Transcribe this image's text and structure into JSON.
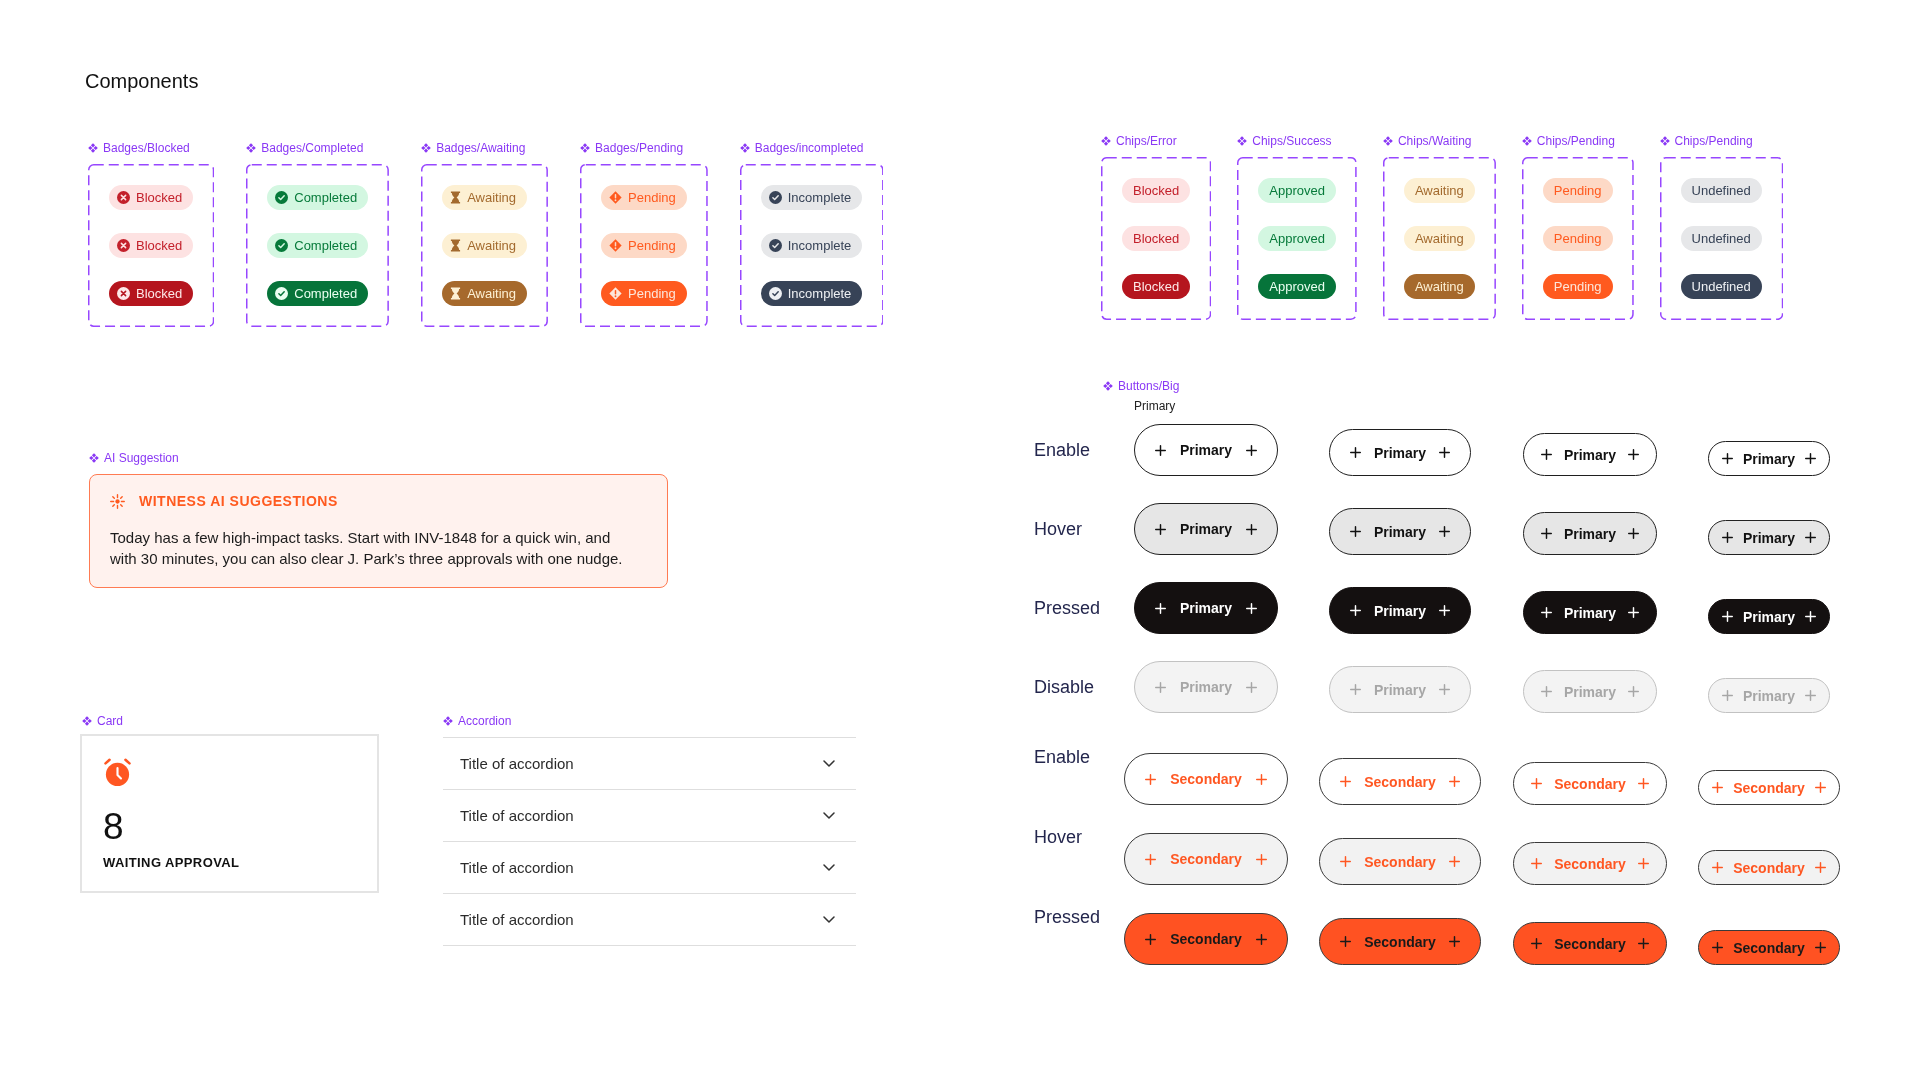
{
  "page": {
    "title": "Components"
  },
  "badge_sets": [
    {
      "label": "Badges/Blocked",
      "kind": "blocked",
      "badges": [
        {
          "text": "Blocked",
          "kind": "soft"
        },
        {
          "text": "Blocked",
          "kind": "outline"
        },
        {
          "text": "Blocked",
          "kind": "solid"
        }
      ]
    },
    {
      "label": "Badges/Completed",
      "kind": "completed",
      "badges": [
        {
          "text": "Completed",
          "kind": "soft"
        },
        {
          "text": "Completed",
          "kind": "outline"
        },
        {
          "text": "Completed",
          "kind": "solid"
        }
      ]
    },
    {
      "label": "Badges/Awaiting",
      "kind": "awaiting",
      "badges": [
        {
          "text": "Awaiting",
          "kind": "soft"
        },
        {
          "text": "Awaiting",
          "kind": "outline"
        },
        {
          "text": "Awaiting",
          "kind": "solid"
        }
      ]
    },
    {
      "label": "Badges/Pending",
      "kind": "pending",
      "badges": [
        {
          "text": "Pending",
          "kind": "soft"
        },
        {
          "text": "Pending",
          "kind": "outline"
        },
        {
          "text": "Pending",
          "kind": "solid"
        }
      ]
    },
    {
      "label": "Badges/incompleted",
      "kind": "incomplete",
      "badges": [
        {
          "text": "Incomplete",
          "kind": "soft"
        },
        {
          "text": "Incomplete",
          "kind": "outline"
        },
        {
          "text": "Incomplete",
          "kind": "solid"
        }
      ]
    }
  ],
  "chip_sets": [
    {
      "label": "Chips/Error",
      "kind": "error",
      "chips": [
        {
          "text": "Blocked",
          "kind": "soft"
        },
        {
          "text": "Blocked",
          "kind": "outline"
        },
        {
          "text": "Blocked",
          "kind": "solid"
        }
      ]
    },
    {
      "label": "Chips/Success",
      "kind": "success",
      "chips": [
        {
          "text": "Approved",
          "kind": "soft"
        },
        {
          "text": "Approved",
          "kind": "outline"
        },
        {
          "text": "Approved",
          "kind": "solid"
        }
      ]
    },
    {
      "label": "Chips/Waiting",
      "kind": "waiting",
      "chips": [
        {
          "text": "Awaiting",
          "kind": "soft"
        },
        {
          "text": "Awaiting",
          "kind": "outline"
        },
        {
          "text": "Awaiting",
          "kind": "solid"
        }
      ]
    },
    {
      "label": "Chips/Pending",
      "kind": "pending",
      "chips": [
        {
          "text": "Pending",
          "kind": "soft"
        },
        {
          "text": "Pending",
          "kind": "outline"
        },
        {
          "text": "Pending",
          "kind": "solid"
        }
      ]
    },
    {
      "label": "Chips/Pending",
      "kind": "undefined",
      "chips": [
        {
          "text": "Undefined",
          "kind": "soft"
        },
        {
          "text": "Undefined",
          "kind": "outline"
        },
        {
          "text": "Undefined",
          "kind": "solid"
        }
      ]
    }
  ],
  "ai_suggestion": {
    "label": "AI Suggestion",
    "heading": "WITNESS AI SUGGESTIONS",
    "body": "Today has a few high-impact tasks. Start with INV-1848 for a quick win, and with 30 minutes, you can also clear J. Park’s three approvals with one nudge."
  },
  "card": {
    "label": "Card",
    "value": "8",
    "caption": "WAITING APPROVAL"
  },
  "accordion": {
    "label": "Accordion",
    "items": [
      {
        "title": "Title of accordion",
        "expanded": false
      },
      {
        "title": "Title of accordion",
        "expanded": false
      },
      {
        "title": "Title of accordion",
        "expanded": false
      },
      {
        "title": "Title of accordion",
        "expanded": false
      }
    ]
  },
  "buttons": {
    "label": "Buttons/Big",
    "groups": [
      {
        "kind": "primary",
        "heading": "Primary",
        "rows": [
          {
            "label": "Enable",
            "kind": "enabled",
            "buttons": [
              "Primary",
              "Primary",
              "Primary",
              "Primary"
            ]
          },
          {
            "label": "Hover",
            "kind": "hover",
            "buttons": [
              "Primary",
              "Primary",
              "Primary",
              "Primary"
            ]
          },
          {
            "label": "Pressed",
            "kind": "pressed",
            "buttons": [
              "Primary",
              "Primary",
              "Primary",
              "Primary"
            ]
          },
          {
            "label": "Disable",
            "kind": "disabled",
            "buttons": [
              "Primary",
              "Primary",
              "Primary",
              "Primary"
            ]
          }
        ]
      },
      {
        "kind": "secondary",
        "rows": [
          {
            "label": "Enable",
            "kind": "enabled",
            "buttons": [
              "Secondary",
              "Secondary",
              "Secondary",
              "Secondary"
            ]
          },
          {
            "label": "Hover",
            "kind": "hover",
            "buttons": [
              "Secondary",
              "Secondary",
              "Secondary",
              "Secondary"
            ]
          },
          {
            "label": "Pressed",
            "kind": "pressed",
            "buttons": [
              "Secondary",
              "Secondary",
              "Secondary",
              "Secondary"
            ]
          }
        ]
      }
    ]
  }
}
